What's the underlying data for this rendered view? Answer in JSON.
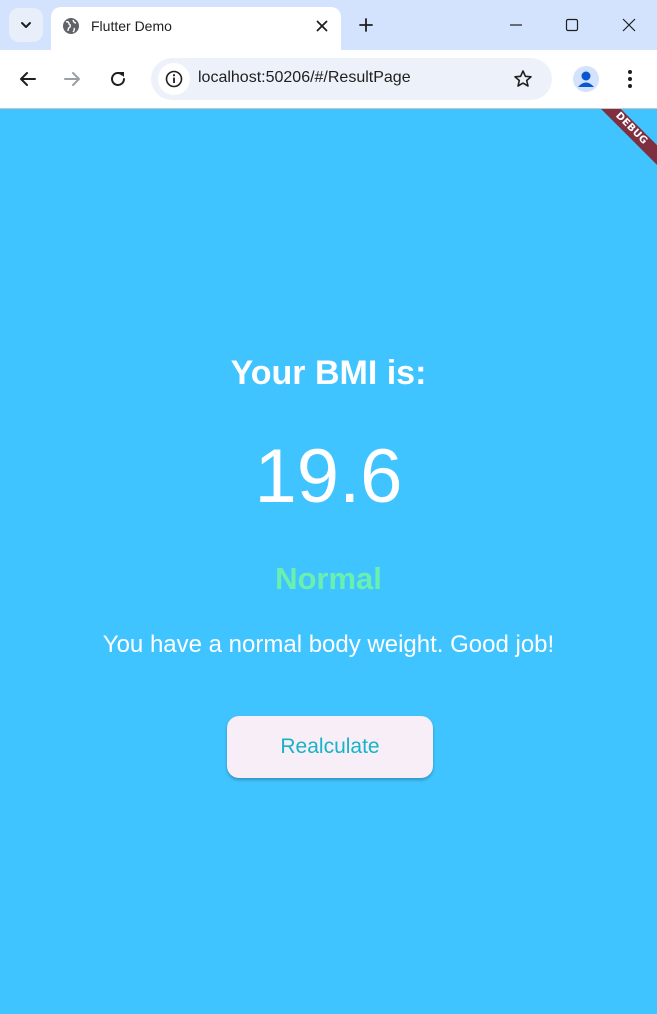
{
  "browser": {
    "tab_title": "Flutter Demo",
    "url": "localhost:50206/#/ResultPage",
    "icons": {
      "tab_search": "chevron-down-icon",
      "favicon": "globe-icon",
      "tab_close": "close-icon",
      "new_tab": "plus-icon",
      "minimize": "minimize-icon",
      "maximize": "maximize-icon",
      "close": "close-icon",
      "back": "arrow-left-icon",
      "forward": "arrow-right-icon",
      "reload": "reload-icon",
      "site_info": "info-icon",
      "bookmark": "star-icon",
      "profile": "person-icon",
      "menu": "kebab-menu-icon"
    }
  },
  "app": {
    "debug_banner": "DEBUG",
    "heading": "Your BMI is:",
    "bmi_value": "19.6",
    "category": "Normal",
    "message": "You have a normal body weight. Good job!",
    "recalculate_label": "Realculate",
    "colors": {
      "background": "#40c4ff",
      "category": "#69f0ae",
      "button_bg": "#f7eef7",
      "button_text": "#17b3c6",
      "debug_banner": "#7f2f3f"
    }
  }
}
